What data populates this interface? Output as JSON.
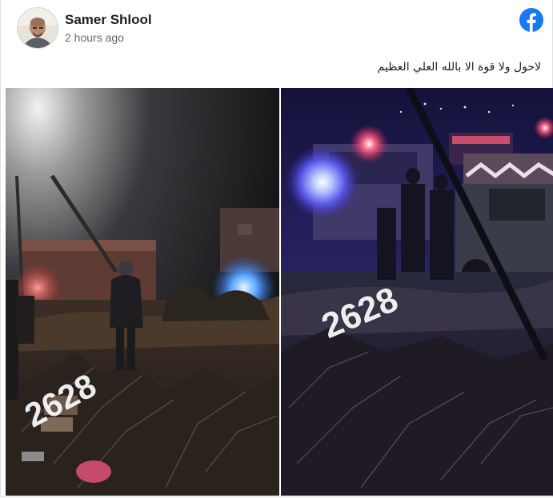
{
  "post": {
    "author": "Samer Shlool",
    "timestamp": "2 hours ago",
    "text": "لاحول ولا قوة الا بالله العلي العظيم",
    "platform_icon": "facebook-icon"
  },
  "photos": {
    "left": {
      "watermark": "2628"
    },
    "right": {
      "watermark": "2628"
    }
  },
  "colors": {
    "brand": "#1877f2",
    "author_text": "#1c1e21",
    "meta_text": "#606770"
  }
}
